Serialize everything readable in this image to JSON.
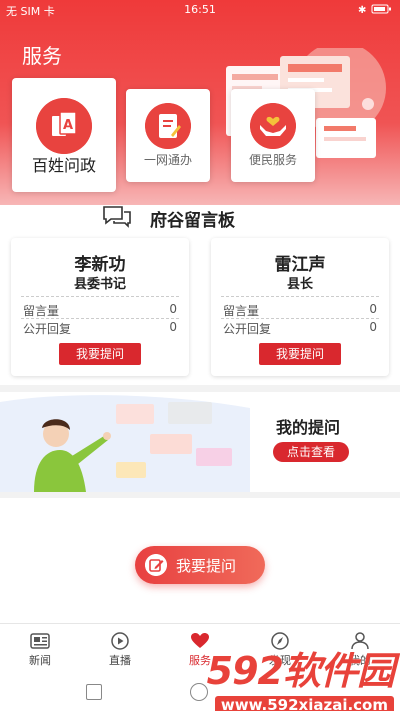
{
  "status_bar": {
    "carrier": "无 SIM 卡",
    "time": "16:51"
  },
  "header": {
    "title": "服务"
  },
  "services": [
    {
      "label": "百姓问政",
      "icon": "document-a-icon"
    },
    {
      "label": "一网通办",
      "icon": "document-pen-icon"
    },
    {
      "label": "便民服务",
      "icon": "hands-heart-icon"
    }
  ],
  "board": {
    "title": "府谷留言板",
    "icon": "chat-bubbles-icon"
  },
  "leaders": [
    {
      "name": "李新功",
      "position": "县委书记",
      "msg_label": "留言量",
      "msg_count": "0",
      "reply_label": "公开回复",
      "reply_count": "0",
      "button": "我要提问"
    },
    {
      "name": "雷江声",
      "position": "县长",
      "msg_label": "留言量",
      "msg_count": "0",
      "reply_label": "公开回复",
      "reply_count": "0",
      "button": "我要提问"
    }
  ],
  "my_questions": {
    "title": "我的提问",
    "button": "点击查看"
  },
  "ask_button": {
    "label": "我要提问",
    "icon": "edit-icon"
  },
  "nav": {
    "items": [
      {
        "label": "新闻",
        "icon": "news-icon"
      },
      {
        "label": "直播",
        "icon": "play-icon"
      },
      {
        "label": "服务",
        "icon": "heart-icon",
        "active": true
      },
      {
        "label": "发现",
        "icon": "compass-icon"
      },
      {
        "label": "我的",
        "icon": "user-icon"
      }
    ]
  },
  "watermark": {
    "brand": "592软件园",
    "url": "www.592xiazai.com"
  },
  "colors": {
    "accent": "#d9282e",
    "header": "#ef3a3a"
  }
}
